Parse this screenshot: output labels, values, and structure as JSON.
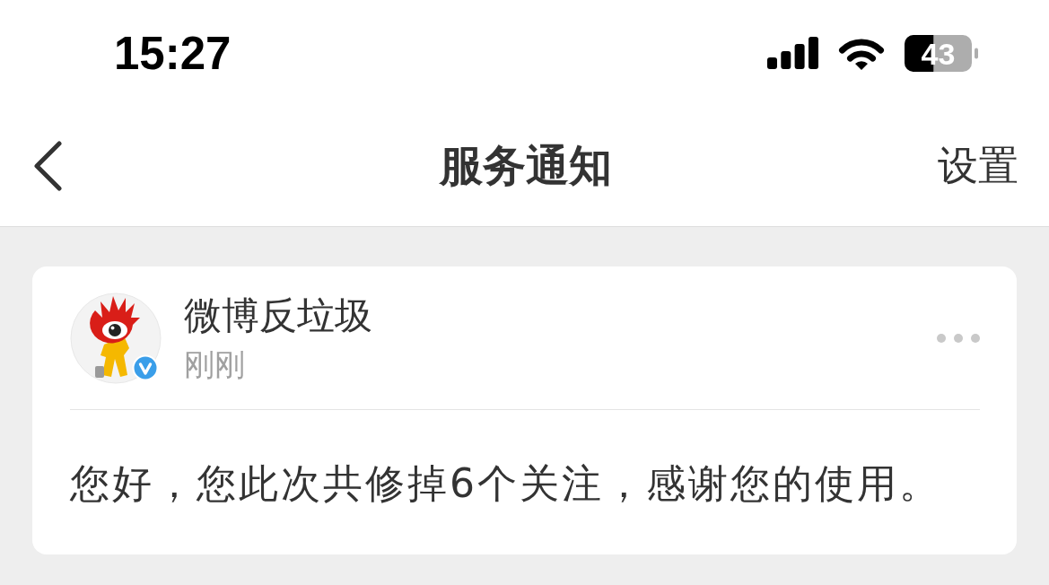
{
  "status_bar": {
    "time": "15:27",
    "battery": "43"
  },
  "nav": {
    "title": "服务通知",
    "action": "设置"
  },
  "notifications": [
    {
      "sender": "微博反垃圾",
      "verified": true,
      "time": "刚刚",
      "message": "您好，您此次共修掉6个关注，感谢您的使用。"
    }
  ]
}
